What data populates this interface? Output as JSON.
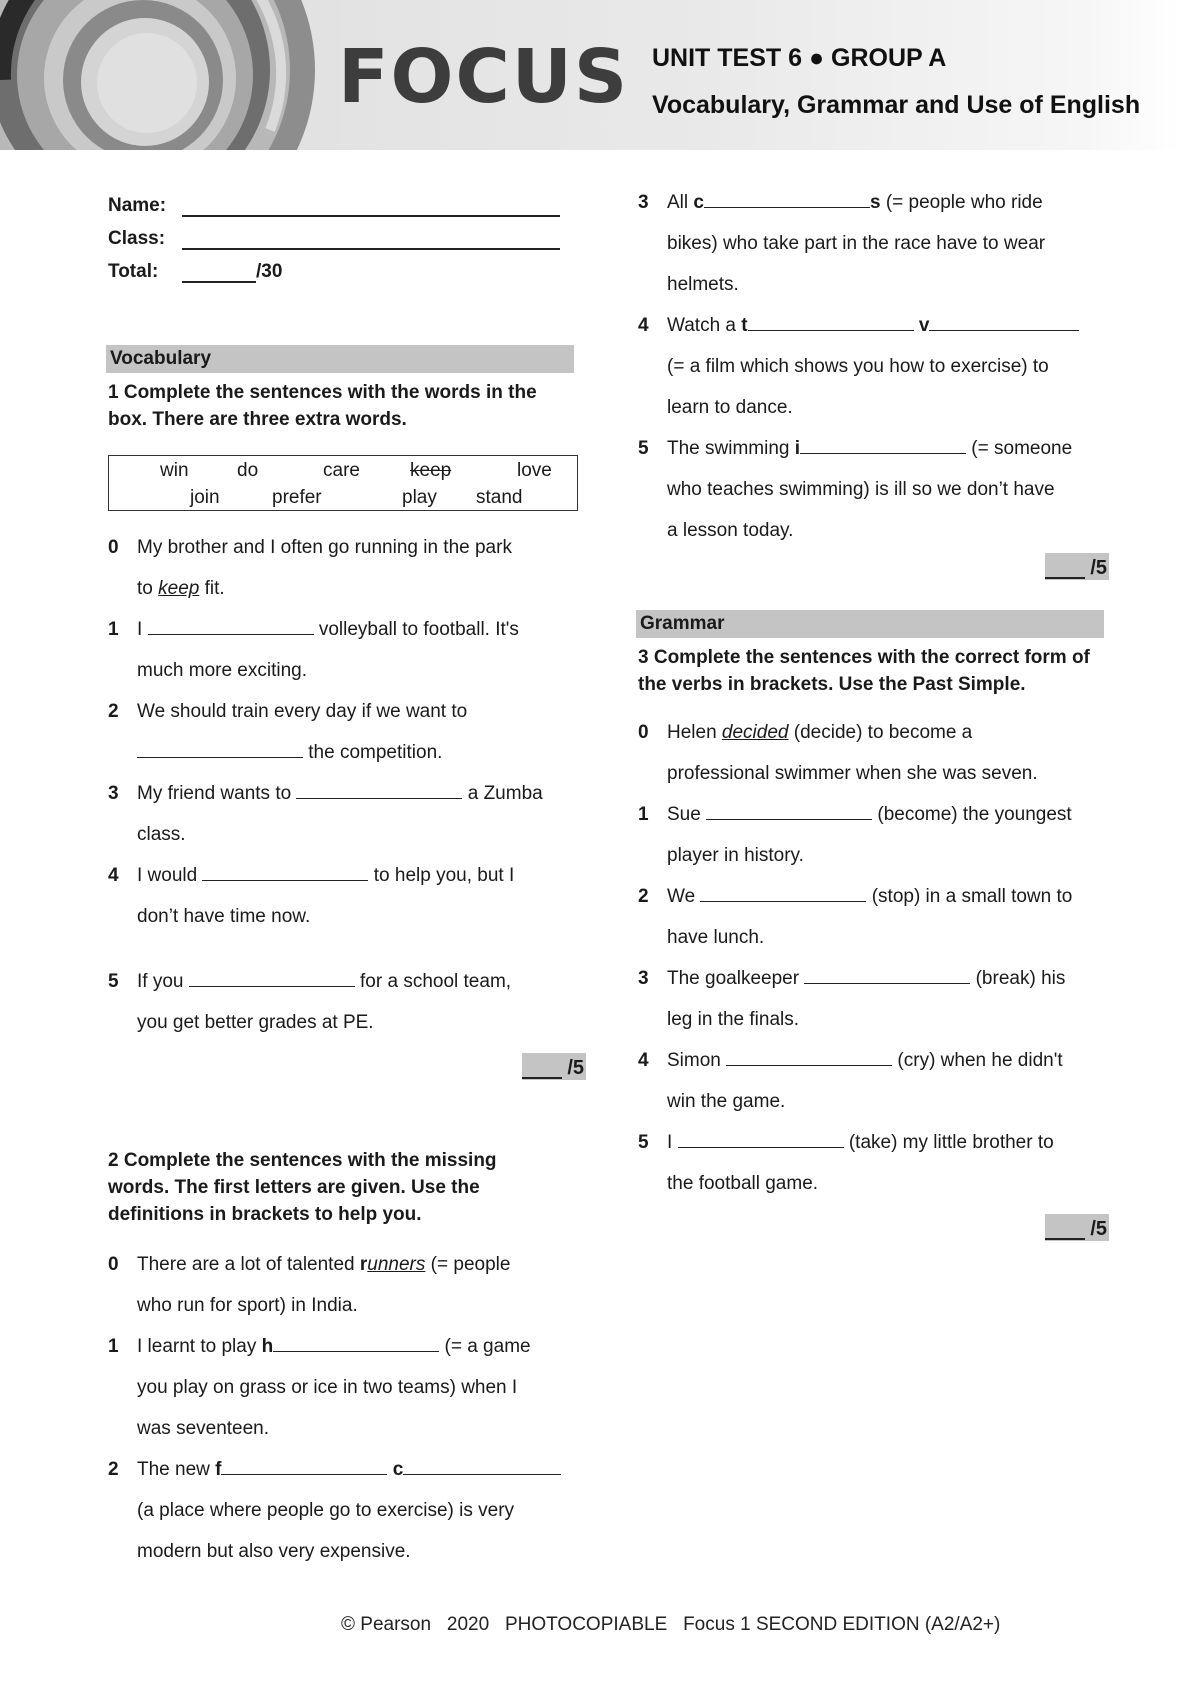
{
  "header": {
    "logo": "FOCUS",
    "unit_title": "UNIT TEST 6 ● GROUP A",
    "subtitle": "Vocabulary, Grammar and Use of English"
  },
  "student_info": {
    "name_label": "Name:",
    "class_label": "Class:",
    "total_label": "Total:",
    "total_max": "/30"
  },
  "vocabulary": {
    "section_title": "Vocabulary",
    "exercise1": {
      "instruction": "1 Complete the sentences with the words in the box. There are three extra words.",
      "word_box": [
        "win",
        "do",
        "care",
        "keep",
        "love",
        "join",
        "prefer",
        "play",
        "stand"
      ],
      "crossed_word": "keep",
      "items": [
        {
          "num": "0",
          "before": "My brother and I often go running in the park",
          "line2_pre": "to ",
          "answer": "keep",
          "line2_post": " fit."
        },
        {
          "num": "1",
          "before": "I ",
          "after": " volleyball to football. It's",
          "line2": "much more exciting."
        },
        {
          "num": "2",
          "before": "We should train every day if we want to",
          "line2_after": " the competition."
        },
        {
          "num": "3",
          "before": "My friend wants to ",
          "after": " a Zumba",
          "line2": "class."
        },
        {
          "num": "4",
          "before": "I would ",
          "after": " to help you, but I",
          "line2": "don’t have time now."
        },
        {
          "num": "5",
          "before": "If you ",
          "after": " for a school team,",
          "line2": "you get better grades at PE."
        }
      ],
      "score": "/5"
    },
    "exercise2": {
      "instruction": "2 Complete the sentences with the missing words. The first letters are given. Use the definitions in brackets to help you.",
      "items": [
        {
          "num": "0",
          "before": "There are a lot of talented ",
          "letter": "r",
          "answer": "unners",
          "after": " (= people",
          "line2": "who run for sport) in India."
        },
        {
          "num": "1",
          "before": "I learnt to play ",
          "letter": "h",
          "after": " (= a game",
          "line2": "you play on grass or ice in two teams) when I",
          "line3": "was seventeen."
        },
        {
          "num": "2",
          "before": "The new ",
          "letter": "f",
          "letter2": "c",
          "line2": "(a place where people go to exercise) is very",
          "line3": "modern but also very expensive."
        },
        {
          "num": "3",
          "before": "All ",
          "letter": "c",
          "suffix": "s",
          "after": " (= people who ride",
          "line2": "bikes) who take part in the race have to wear",
          "line3": "helmets."
        },
        {
          "num": "4",
          "before": "Watch a ",
          "letter": "t",
          "letter2": "v",
          "line2": "(= a film which shows you how to exercise) to",
          "line3": "learn to dance."
        },
        {
          "num": "5",
          "before": "The swimming ",
          "letter": "i",
          "after": " (= someone",
          "line2": "who teaches swimming) is ill so we don’t have",
          "line3": "a lesson today."
        }
      ],
      "score": "/5"
    }
  },
  "grammar": {
    "section_title": "Grammar",
    "exercise3": {
      "instruction": "3 Complete the sentences with the correct form of the verbs in brackets. Use the Past Simple.",
      "items": [
        {
          "num": "0",
          "before": "Helen ",
          "answer": "decided",
          "after": " (decide) to become a",
          "line2": "professional swimmer when she was seven."
        },
        {
          "num": "1",
          "before": "Sue ",
          "after": " (become) the youngest",
          "line2": "player in history."
        },
        {
          "num": "2",
          "before": "We ",
          "after": " (stop) in a small town to",
          "line2": "have lunch."
        },
        {
          "num": "3",
          "before": "The goalkeeper ",
          "after": " (break) his",
          "line2": "leg in the finals."
        },
        {
          "num": "4",
          "before": "Simon ",
          "after": " (cry) when he didn't",
          "line2": "win the game."
        },
        {
          "num": "5",
          "before": "I ",
          "after": " (take) my little brother to",
          "line2": "the football game."
        }
      ],
      "score": "/5"
    }
  },
  "footer": "© Pearson   2020   PHOTOCOPIABLE   Focus 1 SECOND EDITION (A2/A2+)"
}
